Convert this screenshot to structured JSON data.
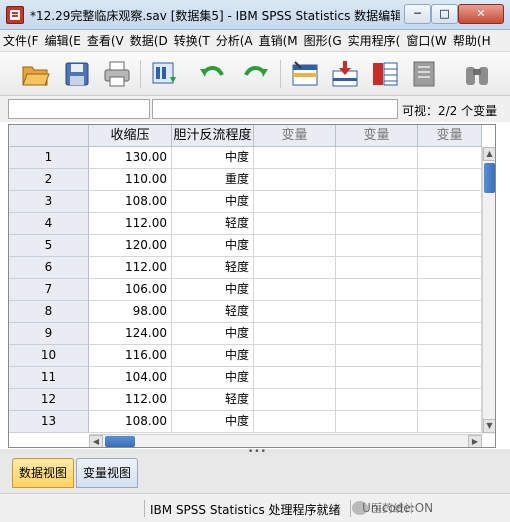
{
  "window": {
    "title": "*12.29完整临床观察.sav [数据集5] - IBM SPSS Statistics 数据编辑...",
    "min_label": "─",
    "max_label": "□",
    "close_label": "✕"
  },
  "menu": [
    "文件(F",
    "编辑(E",
    "查看(V",
    "数据(D",
    "转换(T",
    "分析(A",
    "直销(M",
    "图形(G",
    "实用程序(",
    "窗口(W",
    "帮助(H"
  ],
  "toolbar": {
    "icons": [
      "open-folder-icon",
      "save-icon",
      "print-icon",
      "dialog-recall-icon",
      "undo-icon",
      "redo-icon",
      "goto-case-icon",
      "goto-variable-icon",
      "variables-icon",
      "find-icon",
      "binoculars-icon"
    ]
  },
  "infobar": {
    "cell_reference": "",
    "cell_value": "",
    "visible_count": "可视：2/2 个变量"
  },
  "grid": {
    "columns": [
      "收缩压",
      "胆汁反流程度",
      "变量",
      "变量",
      "变量"
    ],
    "rows": [
      {
        "num": "1",
        "sbp": "130.00",
        "reflux": "中度"
      },
      {
        "num": "2",
        "sbp": "110.00",
        "reflux": "重度"
      },
      {
        "num": "3",
        "sbp": "108.00",
        "reflux": "中度"
      },
      {
        "num": "4",
        "sbp": "112.00",
        "reflux": "轻度"
      },
      {
        "num": "5",
        "sbp": "120.00",
        "reflux": "中度"
      },
      {
        "num": "6",
        "sbp": "112.00",
        "reflux": "轻度"
      },
      {
        "num": "7",
        "sbp": "106.00",
        "reflux": "中度"
      },
      {
        "num": "8",
        "sbp": "98.00",
        "reflux": "轻度"
      },
      {
        "num": "9",
        "sbp": "124.00",
        "reflux": "中度"
      },
      {
        "num": "10",
        "sbp": "116.00",
        "reflux": "中度"
      },
      {
        "num": "11",
        "sbp": "104.00",
        "reflux": "中度"
      },
      {
        "num": "12",
        "sbp": "112.00",
        "reflux": "轻度"
      },
      {
        "num": "13",
        "sbp": "108.00",
        "reflux": "中度"
      }
    ]
  },
  "tabs": {
    "data_view": "数据视图",
    "variable_view": "变量视图"
  },
  "status": {
    "processor": "IBM SPSS Statistics 处理程序就绪",
    "encoding": "Unicode:ON",
    "watermark": "医药统计"
  },
  "colors": {
    "active_tab": "#ffd265",
    "header_bg": "#e9ecf3",
    "scroll_thumb": "#3a6fb9"
  }
}
